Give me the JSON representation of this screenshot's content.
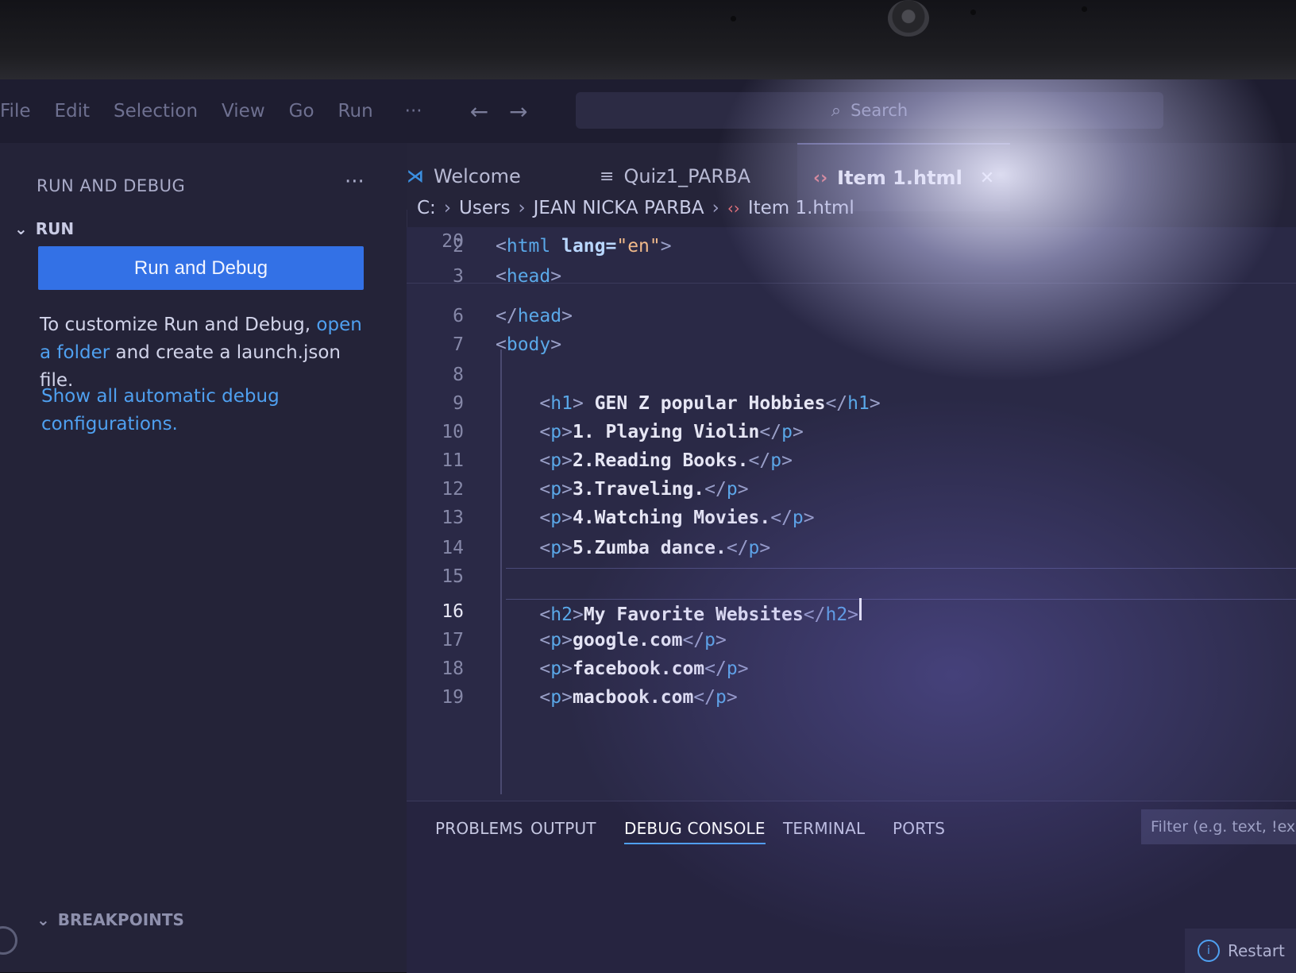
{
  "menubar": {
    "items": [
      "File",
      "Edit",
      "Selection",
      "View",
      "Go",
      "Run"
    ],
    "more": "···",
    "back": "←",
    "forward": "→",
    "search_placeholder": "Search"
  },
  "sidebar": {
    "title": "RUN AND DEBUG",
    "more": "···",
    "section": "RUN",
    "run_button": "Run and Debug",
    "hint_prefix": "To customize Run and Debug, ",
    "hint_link": "open a folder",
    "hint_suffix": " and create a launch.json file.",
    "show_all_link": "Show all automatic debug configurations.",
    "breakpoints": "BREAKPOINTS"
  },
  "tabs": [
    {
      "label": "Welcome",
      "icon": "vscode-icon"
    },
    {
      "label": "Quiz1_PARBA",
      "icon": "text-file-icon"
    },
    {
      "label": "Item 1.html",
      "icon": "html-icon",
      "active": true
    }
  ],
  "breadcrumb": [
    "C:",
    "Users",
    "JEAN NICKA PARBA",
    "Item 1.html"
  ],
  "editor": {
    "lines": [
      {
        "n": "2",
        "open": "<",
        "tag": "html",
        "attr": " lang=",
        "str": "\"en\"",
        "close": ">"
      },
      {
        "n": "3",
        "open": "<",
        "tag": "head",
        "close": ">"
      },
      {
        "n": "6",
        "open": "</",
        "tag": "head",
        "close": ">"
      },
      {
        "n": "7",
        "open": "<",
        "tag": "body",
        "close": ">"
      },
      {
        "n": "8"
      },
      {
        "n": "9",
        "indent": "    ",
        "open": "<",
        "tag": "h1",
        "close": ">",
        "text": " GEN Z popular Hobbies",
        "eopen": "</",
        "etag": "h1",
        "eclose": ">"
      },
      {
        "n": "10",
        "indent": "    ",
        "open": "<",
        "tag": "p",
        "close": ">",
        "text": "1. Playing Violin",
        "eopen": "</",
        "etag": "p",
        "eclose": ">"
      },
      {
        "n": "11",
        "indent": "    ",
        "open": "<",
        "tag": "p",
        "close": ">",
        "text": "2.Reading Books.",
        "eopen": "</",
        "etag": "p",
        "eclose": ">"
      },
      {
        "n": "12",
        "indent": "    ",
        "open": "<",
        "tag": "p",
        "close": ">",
        "text": "3.Traveling.",
        "eopen": "</",
        "etag": "p",
        "eclose": ">"
      },
      {
        "n": "13",
        "indent": "    ",
        "open": "<",
        "tag": "p",
        "close": ">",
        "text": "4.Watching Movies.",
        "eopen": "</",
        "etag": "p",
        "eclose": ">"
      },
      {
        "n": "14",
        "indent": "    ",
        "open": "<",
        "tag": "p",
        "close": ">",
        "text": "5.Zumba dance.",
        "eopen": "</",
        "etag": "p",
        "eclose": ">"
      },
      {
        "n": "15"
      },
      {
        "n": "16",
        "indent": "    ",
        "open": "<",
        "tag": "h2",
        "close": ">",
        "text": "My Favorite Websites",
        "eopen": "</",
        "etag": "h2",
        "eclose": ">",
        "current": true
      },
      {
        "n": "17",
        "indent": "    ",
        "open": "<",
        "tag": "p",
        "close": ">",
        "text": "google.com",
        "eopen": "</",
        "etag": "p",
        "eclose": ">"
      },
      {
        "n": "18",
        "indent": "    ",
        "open": "<",
        "tag": "p",
        "close": ">",
        "text": "facebook.com",
        "eopen": "</",
        "etag": "p",
        "eclose": ">"
      },
      {
        "n": "19",
        "indent": "    ",
        "open": "<",
        "tag": "p",
        "close": ">",
        "text": "macbook.com",
        "eopen": "</",
        "etag": "p",
        "eclose": ">"
      },
      {
        "n": "20"
      }
    ]
  },
  "panel": {
    "tabs": [
      "PROBLEMS",
      "OUTPUT",
      "DEBUG CONSOLE",
      "TERMINAL",
      "PORTS"
    ],
    "active_tab": "DEBUG CONSOLE",
    "filter_placeholder": "Filter (e.g. text, !ex",
    "restart": "Restart"
  },
  "colors": {
    "accent": "#3371e6",
    "link": "#4fa0f0",
    "tag": "#5aa8e8",
    "string": "#f0b98a"
  }
}
